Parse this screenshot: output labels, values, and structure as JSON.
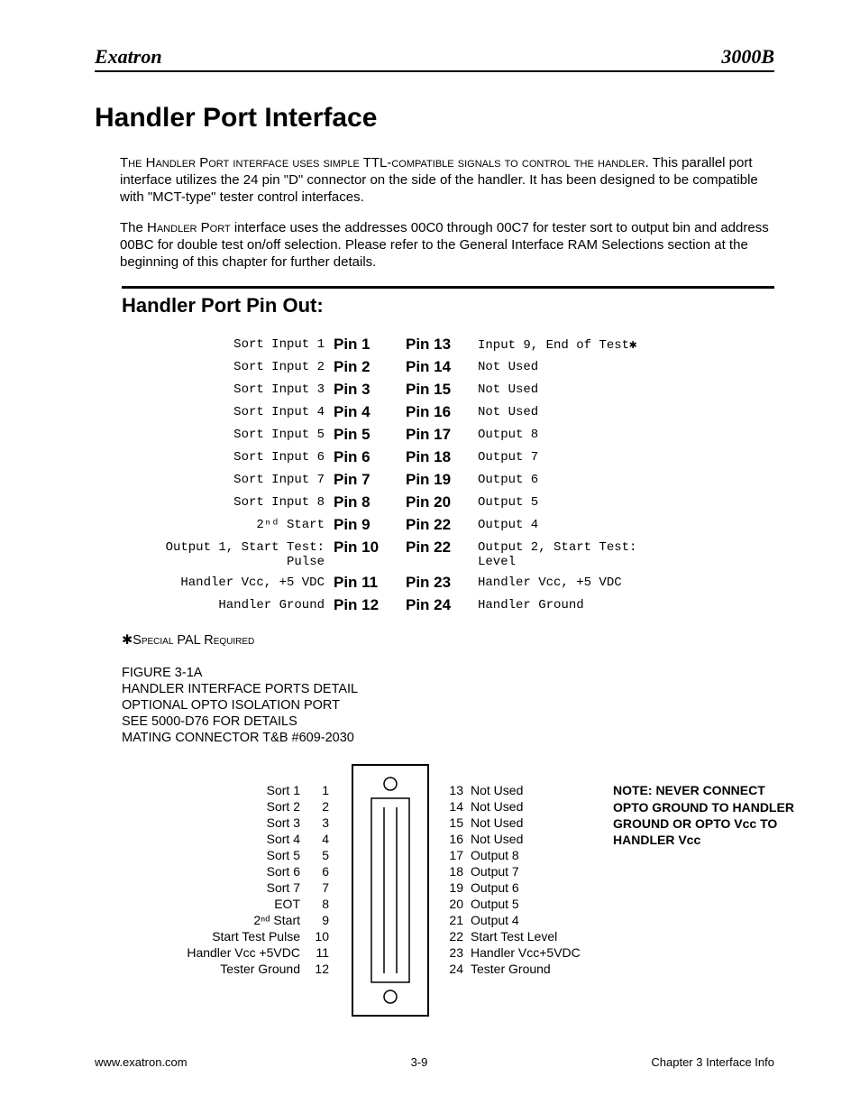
{
  "header": {
    "left": "Exatron",
    "right": "3000B"
  },
  "title": "Handler Port Interface",
  "para1_lead": "The Handler Port interface uses simple TTL-compatible signals to control the handler.",
  "para1_rest": "  This parallel port interface utilizes the 24 pin \"D\" connector on the side of the handler.  It has been designed to be compatible with \"MCT-type\" tester control interfaces.",
  "para2_a": "The ",
  "para2_sc": "Handler Port",
  "para2_b": " interface uses the addresses 00C0 through 00C7 for tester sort to output bin and address 00BC for double test on/off selection.  Please refer to the General Interface RAM Selections section at the beginning of this chapter for further details.",
  "sub": "Handler Port Pin Out:",
  "pins": [
    {
      "ld": "Sort Input 1",
      "ll": "Pin 1",
      "rl": "Pin 13",
      "rd": "Input 9, End of Test✱"
    },
    {
      "ld": "Sort Input 2",
      "ll": "Pin 2",
      "rl": "Pin 14",
      "rd": "Not Used"
    },
    {
      "ld": "Sort Input 3",
      "ll": "Pin 3",
      "rl": "Pin 15",
      "rd": "Not Used"
    },
    {
      "ld": "Sort Input 4",
      "ll": "Pin 4",
      "rl": "Pin 16",
      "rd": "Not Used"
    },
    {
      "ld": "Sort Input 5",
      "ll": "Pin 5",
      "rl": "Pin 17",
      "rd": "Output 8"
    },
    {
      "ld": "Sort Input 6",
      "ll": "Pin 6",
      "rl": "Pin 18",
      "rd": "Output 7"
    },
    {
      "ld": "Sort Input 7",
      "ll": "Pin 7",
      "rl": "Pin 19",
      "rd": "Output 6"
    },
    {
      "ld": "Sort Input 8",
      "ll": "Pin 8",
      "rl": "Pin 20",
      "rd": "Output 5"
    },
    {
      "ld": "2ⁿᵈ Start",
      "ll": "Pin 9",
      "rl": "Pin 22",
      "rd": "Output 4"
    },
    {
      "ld": "Output 1, Start Test: Pulse",
      "ll": "Pin 10",
      "rl": "Pin 22",
      "rd": "Output 2, Start Test: Level"
    },
    {
      "ld": "Handler Vcc, +5 VDC",
      "ll": "Pin 11",
      "rl": "Pin 23",
      "rd": "Handler Vcc, +5 VDC"
    },
    {
      "ld": "Handler Ground",
      "ll": "Pin 12",
      "rl": "Pin 24",
      "rd": "Handler Ground"
    }
  ],
  "note_star": "✱Special PAL Required",
  "fig_lines": [
    "FIGURE 3-1A",
    "HANDLER INTERFACE PORTS DETAIL",
    "OPTIONAL OPTO ISOLATION PORT",
    "SEE 5000-D76 FOR DETAILS",
    "MATING CONNECTOR  T&B #609-2030"
  ],
  "conn_left": [
    {
      "t": "Sort 1",
      "n": "1"
    },
    {
      "t": "Sort 2",
      "n": "2"
    },
    {
      "t": "Sort 3",
      "n": "3"
    },
    {
      "t": "Sort 4",
      "n": "4"
    },
    {
      "t": "Sort 5",
      "n": "5"
    },
    {
      "t": "Sort 6",
      "n": "6"
    },
    {
      "t": "Sort 7",
      "n": "7"
    },
    {
      "t": "EOT",
      "n": "8"
    },
    {
      "t": "2ⁿᵈ Start",
      "n": "9"
    },
    {
      "t": "Start Test Pulse",
      "n": "10"
    },
    {
      "t": "Handler Vcc +5VDC",
      "n": "11"
    },
    {
      "t": "Tester Ground",
      "n": "12"
    }
  ],
  "conn_right": [
    {
      "n": "13",
      "t": "Not Used"
    },
    {
      "n": "14",
      "t": "Not Used"
    },
    {
      "n": "15",
      "t": "Not Used"
    },
    {
      "n": "16",
      "t": "Not Used"
    },
    {
      "n": "17",
      "t": "Output 8"
    },
    {
      "n": "18",
      "t": "Output 7"
    },
    {
      "n": "19",
      "t": "Output 6"
    },
    {
      "n": "20",
      "t": "Output 5"
    },
    {
      "n": "21",
      "t": "Output 4"
    },
    {
      "n": "22",
      "t": "Start Test Level"
    },
    {
      "n": "23",
      "t": "Handler Vcc+5VDC"
    },
    {
      "n": "24",
      "t": "Tester Ground"
    }
  ],
  "warning": "NOTE: NEVER CONNECT OPTO GROUND TO HANDLER GROUND OR OPTO Vcc TO HANDLER Vcc",
  "footer": {
    "left": "www.exatron.com",
    "center": "3-9",
    "right": "Chapter 3 Interface Info"
  }
}
